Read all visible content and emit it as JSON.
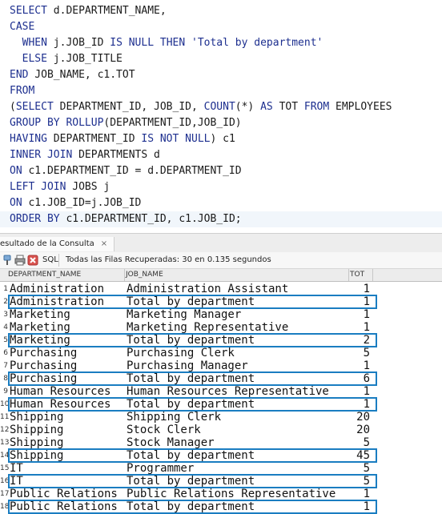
{
  "editor": {
    "lines": [
      [
        {
          "t": "kw",
          "v": "SELECT"
        },
        {
          "t": "id",
          "v": " d.DEPARTMENT_NAME,"
        }
      ],
      [
        {
          "t": "kw",
          "v": "CASE"
        }
      ],
      [
        {
          "t": "id",
          "v": "  "
        },
        {
          "t": "kw",
          "v": "WHEN"
        },
        {
          "t": "id",
          "v": " j.JOB_ID "
        },
        {
          "t": "kw",
          "v": "IS NULL THEN"
        },
        {
          "t": "id",
          "v": " "
        },
        {
          "t": "str",
          "v": "'Total by department'"
        }
      ],
      [
        {
          "t": "id",
          "v": "  "
        },
        {
          "t": "kw",
          "v": "ELSE"
        },
        {
          "t": "id",
          "v": " j.JOB_TITLE"
        }
      ],
      [
        {
          "t": "kw",
          "v": "END"
        },
        {
          "t": "id",
          "v": " JOB_NAME, c1.TOT"
        }
      ],
      [
        {
          "t": "kw",
          "v": "FROM"
        }
      ],
      [
        {
          "t": "id",
          "v": "("
        },
        {
          "t": "kw",
          "v": "SELECT"
        },
        {
          "t": "id",
          "v": " DEPARTMENT_ID, JOB_ID, "
        },
        {
          "t": "kw",
          "v": "COUNT"
        },
        {
          "t": "id",
          "v": "(*) "
        },
        {
          "t": "kw",
          "v": "AS"
        },
        {
          "t": "id",
          "v": " TOT "
        },
        {
          "t": "kw",
          "v": "FROM"
        },
        {
          "t": "id",
          "v": " EMPLOYEES"
        }
      ],
      [
        {
          "t": "kw",
          "v": "GROUP BY ROLLUP"
        },
        {
          "t": "id",
          "v": "(DEPARTMENT_ID,JOB_ID)"
        }
      ],
      [
        {
          "t": "kw",
          "v": "HAVING"
        },
        {
          "t": "id",
          "v": " DEPARTMENT_ID "
        },
        {
          "t": "kw",
          "v": "IS NOT NULL"
        },
        {
          "t": "id",
          "v": ") c1"
        }
      ],
      [
        {
          "t": "kw",
          "v": "INNER JOIN"
        },
        {
          "t": "id",
          "v": " DEPARTMENTS d"
        }
      ],
      [
        {
          "t": "kw",
          "v": "ON"
        },
        {
          "t": "id",
          "v": " c1.DEPARTMENT_ID = d.DEPARTMENT_ID"
        }
      ],
      [
        {
          "t": "kw",
          "v": "LEFT JOIN"
        },
        {
          "t": "id",
          "v": " JOBS j"
        }
      ],
      [
        {
          "t": "kw",
          "v": "ON"
        },
        {
          "t": "id",
          "v": " c1.JOB_ID=j.JOB_ID"
        }
      ],
      [
        {
          "t": "kw",
          "v": "ORDER BY"
        },
        {
          "t": "id",
          "v": " c1.DEPARTMENT_ID, c1.JOB_ID;"
        }
      ]
    ]
  },
  "result_panel": {
    "tab_label": "esultado de la Consulta",
    "tab_close": "×",
    "toolbar": {
      "pin_icon": "pin-icon",
      "print_icon": "print-icon",
      "close_icon": "cancel-query-icon",
      "sql_label": "SQL",
      "status": "Todas las Filas Recuperadas: 30 en 0.135 segundos"
    }
  },
  "grid": {
    "columns": [
      "DEPARTMENT_NAME",
      "JOB_NAME",
      "TOT"
    ],
    "rows": [
      {
        "n": "1",
        "dept": "Administration",
        "job": "Administration Assistant",
        "tot": "1",
        "highlight": false
      },
      {
        "n": "2",
        "dept": "Administration",
        "job": "Total by department",
        "tot": "1",
        "highlight": true
      },
      {
        "n": "3",
        "dept": "Marketing",
        "job": "Marketing Manager",
        "tot": "1",
        "highlight": false
      },
      {
        "n": "4",
        "dept": "Marketing",
        "job": "Marketing Representative",
        "tot": "1",
        "highlight": false
      },
      {
        "n": "5",
        "dept": "Marketing",
        "job": "Total by department",
        "tot": "2",
        "highlight": true
      },
      {
        "n": "6",
        "dept": "Purchasing",
        "job": "Purchasing Clerk",
        "tot": "5",
        "highlight": false
      },
      {
        "n": "7",
        "dept": "Purchasing",
        "job": "Purchasing Manager",
        "tot": "1",
        "highlight": false
      },
      {
        "n": "8",
        "dept": "Purchasing",
        "job": "Total by department",
        "tot": "6",
        "highlight": true
      },
      {
        "n": "9",
        "dept": "Human Resources",
        "job": "Human Resources Representative",
        "tot": "1",
        "highlight": false
      },
      {
        "n": "10",
        "dept": "Human Resources",
        "job": "Total by department",
        "tot": "1",
        "highlight": true
      },
      {
        "n": "11",
        "dept": "Shipping",
        "job": "Shipping Clerk",
        "tot": "20",
        "highlight": false
      },
      {
        "n": "12",
        "dept": "Shipping",
        "job": "Stock Clerk",
        "tot": "20",
        "highlight": false
      },
      {
        "n": "13",
        "dept": "Shipping",
        "job": "Stock Manager",
        "tot": "5",
        "highlight": false
      },
      {
        "n": "14",
        "dept": "Shipping",
        "job": "Total by department",
        "tot": "45",
        "highlight": true
      },
      {
        "n": "15",
        "dept": "IT",
        "job": "Programmer",
        "tot": "5",
        "highlight": false
      },
      {
        "n": "16",
        "dept": "IT",
        "job": "Total by department",
        "tot": "5",
        "highlight": true
      },
      {
        "n": "17",
        "dept": "Public Relations",
        "job": "Public Relations Representative",
        "tot": "1",
        "highlight": false
      },
      {
        "n": "18",
        "dept": "Public Relations",
        "job": "Total by department",
        "tot": "1",
        "highlight": true
      }
    ]
  }
}
